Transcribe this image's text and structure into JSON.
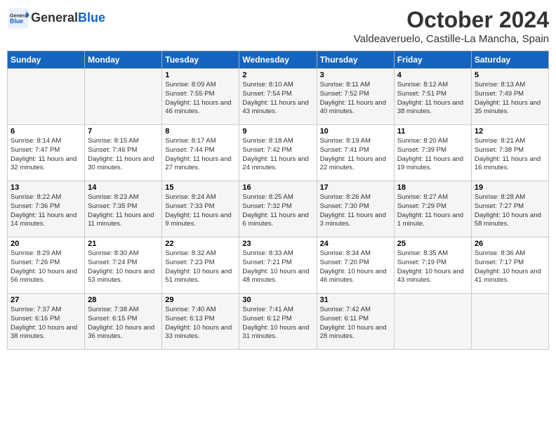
{
  "header": {
    "logo_line1": "General",
    "logo_line2": "Blue",
    "month": "October 2024",
    "location": "Valdeaveruelo, Castille-La Mancha, Spain"
  },
  "weekdays": [
    "Sunday",
    "Monday",
    "Tuesday",
    "Wednesday",
    "Thursday",
    "Friday",
    "Saturday"
  ],
  "weeks": [
    [
      {
        "day": "",
        "info": ""
      },
      {
        "day": "",
        "info": ""
      },
      {
        "day": "1",
        "info": "Sunrise: 8:09 AM\nSunset: 7:55 PM\nDaylight: 11 hours and 46 minutes."
      },
      {
        "day": "2",
        "info": "Sunrise: 8:10 AM\nSunset: 7:54 PM\nDaylight: 11 hours and 43 minutes."
      },
      {
        "day": "3",
        "info": "Sunrise: 8:11 AM\nSunset: 7:52 PM\nDaylight: 11 hours and 40 minutes."
      },
      {
        "day": "4",
        "info": "Sunrise: 8:12 AM\nSunset: 7:51 PM\nDaylight: 11 hours and 38 minutes."
      },
      {
        "day": "5",
        "info": "Sunrise: 8:13 AM\nSunset: 7:49 PM\nDaylight: 11 hours and 35 minutes."
      }
    ],
    [
      {
        "day": "6",
        "info": "Sunrise: 8:14 AM\nSunset: 7:47 PM\nDaylight: 11 hours and 32 minutes."
      },
      {
        "day": "7",
        "info": "Sunrise: 8:15 AM\nSunset: 7:46 PM\nDaylight: 11 hours and 30 minutes."
      },
      {
        "day": "8",
        "info": "Sunrise: 8:17 AM\nSunset: 7:44 PM\nDaylight: 11 hours and 27 minutes."
      },
      {
        "day": "9",
        "info": "Sunrise: 8:18 AM\nSunset: 7:42 PM\nDaylight: 11 hours and 24 minutes."
      },
      {
        "day": "10",
        "info": "Sunrise: 8:19 AM\nSunset: 7:41 PM\nDaylight: 11 hours and 22 minutes."
      },
      {
        "day": "11",
        "info": "Sunrise: 8:20 AM\nSunset: 7:39 PM\nDaylight: 11 hours and 19 minutes."
      },
      {
        "day": "12",
        "info": "Sunrise: 8:21 AM\nSunset: 7:38 PM\nDaylight: 11 hours and 16 minutes."
      }
    ],
    [
      {
        "day": "13",
        "info": "Sunrise: 8:22 AM\nSunset: 7:36 PM\nDaylight: 11 hours and 14 minutes."
      },
      {
        "day": "14",
        "info": "Sunrise: 8:23 AM\nSunset: 7:35 PM\nDaylight: 11 hours and 11 minutes."
      },
      {
        "day": "15",
        "info": "Sunrise: 8:24 AM\nSunset: 7:33 PM\nDaylight: 11 hours and 9 minutes."
      },
      {
        "day": "16",
        "info": "Sunrise: 8:25 AM\nSunset: 7:32 PM\nDaylight: 11 hours and 6 minutes."
      },
      {
        "day": "17",
        "info": "Sunrise: 8:26 AM\nSunset: 7:30 PM\nDaylight: 11 hours and 3 minutes."
      },
      {
        "day": "18",
        "info": "Sunrise: 8:27 AM\nSunset: 7:29 PM\nDaylight: 11 hours and 1 minute."
      },
      {
        "day": "19",
        "info": "Sunrise: 8:28 AM\nSunset: 7:27 PM\nDaylight: 10 hours and 58 minutes."
      }
    ],
    [
      {
        "day": "20",
        "info": "Sunrise: 8:29 AM\nSunset: 7:26 PM\nDaylight: 10 hours and 56 minutes."
      },
      {
        "day": "21",
        "info": "Sunrise: 8:30 AM\nSunset: 7:24 PM\nDaylight: 10 hours and 53 minutes."
      },
      {
        "day": "22",
        "info": "Sunrise: 8:32 AM\nSunset: 7:23 PM\nDaylight: 10 hours and 51 minutes."
      },
      {
        "day": "23",
        "info": "Sunrise: 8:33 AM\nSunset: 7:21 PM\nDaylight: 10 hours and 48 minutes."
      },
      {
        "day": "24",
        "info": "Sunrise: 8:34 AM\nSunset: 7:20 PM\nDaylight: 10 hours and 46 minutes."
      },
      {
        "day": "25",
        "info": "Sunrise: 8:35 AM\nSunset: 7:19 PM\nDaylight: 10 hours and 43 minutes."
      },
      {
        "day": "26",
        "info": "Sunrise: 8:36 AM\nSunset: 7:17 PM\nDaylight: 10 hours and 41 minutes."
      }
    ],
    [
      {
        "day": "27",
        "info": "Sunrise: 7:37 AM\nSunset: 6:16 PM\nDaylight: 10 hours and 38 minutes."
      },
      {
        "day": "28",
        "info": "Sunrise: 7:38 AM\nSunset: 6:15 PM\nDaylight: 10 hours and 36 minutes."
      },
      {
        "day": "29",
        "info": "Sunrise: 7:40 AM\nSunset: 6:13 PM\nDaylight: 10 hours and 33 minutes."
      },
      {
        "day": "30",
        "info": "Sunrise: 7:41 AM\nSunset: 6:12 PM\nDaylight: 10 hours and 31 minutes."
      },
      {
        "day": "31",
        "info": "Sunrise: 7:42 AM\nSunset: 6:11 PM\nDaylight: 10 hours and 28 minutes."
      },
      {
        "day": "",
        "info": ""
      },
      {
        "day": "",
        "info": ""
      }
    ]
  ]
}
